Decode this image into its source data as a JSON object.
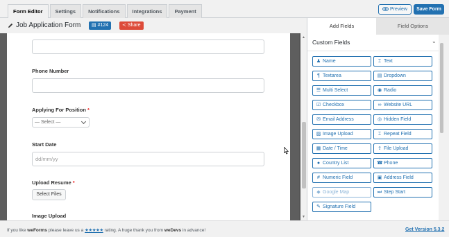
{
  "tabs": [
    {
      "label": "Form Editor",
      "active": true
    },
    {
      "label": "Settings",
      "active": false
    },
    {
      "label": "Notifications",
      "active": false
    },
    {
      "label": "Integrations",
      "active": false
    },
    {
      "label": "Payment",
      "active": false
    }
  ],
  "toolbar": {
    "preview_label": "Preview",
    "save_label": "Save Form"
  },
  "form": {
    "title": "Job Application Form",
    "id_badge": "#124",
    "share_label": "Share"
  },
  "fields": {
    "phone_label": "Phone Number",
    "position_label": "Applying For Position",
    "position_required": "*",
    "position_select": "— Select —",
    "start_label": "Start Date",
    "start_placeholder": "dd/mm/yy",
    "resume_label": "Upload Resume",
    "resume_required": "*",
    "resume_button": "Select Files",
    "image_label": "Image Upload"
  },
  "panel": {
    "tab_add": "Add Fields",
    "tab_options": "Field Options",
    "section_title": "Custom Fields",
    "buttons": [
      {
        "label": "Name",
        "icon": "user-icon",
        "glyph": "♟"
      },
      {
        "label": "Text",
        "icon": "text-cursor-icon",
        "glyph": "⌶"
      },
      {
        "label": "Textarea",
        "icon": "paragraph-icon",
        "glyph": "¶"
      },
      {
        "label": "Dropdown",
        "icon": "dropdown-icon",
        "glyph": "▤"
      },
      {
        "label": "Multi Select",
        "icon": "list-icon",
        "glyph": "☰"
      },
      {
        "label": "Radio",
        "icon": "radio-icon",
        "glyph": "◉"
      },
      {
        "label": "Checkbox",
        "icon": "checkbox-icon",
        "glyph": "☑"
      },
      {
        "label": "Website URL",
        "icon": "link-icon",
        "glyph": "∞"
      },
      {
        "label": "Email Address",
        "icon": "envelope-icon",
        "glyph": "✉"
      },
      {
        "label": "Hidden Field",
        "icon": "eye-slash-icon",
        "glyph": "◎"
      },
      {
        "label": "Image Upload",
        "icon": "image-icon",
        "glyph": "▨"
      },
      {
        "label": "Repeat Field",
        "icon": "text-cursor-icon",
        "glyph": "⌶"
      },
      {
        "label": "Date / Time",
        "icon": "calendar-icon",
        "glyph": "▦"
      },
      {
        "label": "File Upload",
        "icon": "upload-icon",
        "glyph": "⇪"
      },
      {
        "label": "Country List",
        "icon": "globe-icon",
        "glyph": "●"
      },
      {
        "label": "Phone",
        "icon": "phone-icon",
        "glyph": "☎"
      },
      {
        "label": "Numeric Field",
        "icon": "hash-icon",
        "glyph": "#"
      },
      {
        "label": "Address Field",
        "icon": "address-card-icon",
        "glyph": "▣"
      },
      {
        "label": "Google Map",
        "icon": "map-marker-icon",
        "glyph": "◆",
        "disabled": true
      },
      {
        "label": "Step Start",
        "icon": "step-icon",
        "glyph": "⏭"
      },
      {
        "label": "Signature Field",
        "icon": "signature-icon",
        "glyph": "✎"
      }
    ]
  },
  "footer": {
    "prefix": "If you like",
    "brand": "weForms",
    "middle": "please leave us a",
    "stars": "★★★★★",
    "suffix": "rating. A huge thank you from",
    "team": "weDevs",
    "end": "in advance!",
    "version": "Get Version 5.3.2"
  },
  "colors": {
    "accent": "#2271b1",
    "share": "#dd4b39",
    "required": "#ee2222"
  }
}
